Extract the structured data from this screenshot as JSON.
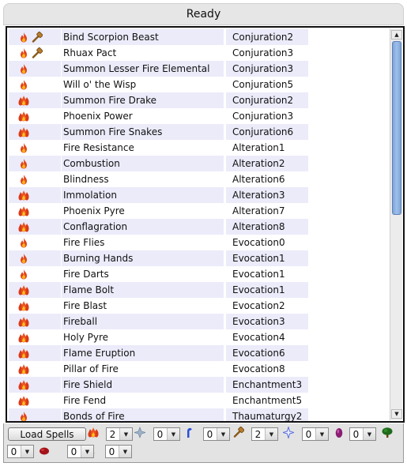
{
  "status": "Ready",
  "colors": {
    "row_alt": "#ebebfa",
    "scroll_thumb": "#8fb2e2",
    "fire": "#e0451c"
  },
  "spells": [
    {
      "name": "Bind Scorpion Beast",
      "school": "Conjuration2",
      "icons": [
        "fire-icon",
        "hammer-icon"
      ],
      "fire_level": 1
    },
    {
      "name": "Rhuax Pact",
      "school": "Conjuration3",
      "icons": [
        "fire-icon",
        "hammer-icon"
      ],
      "fire_level": 1
    },
    {
      "name": "Summon Lesser Fire Elemental",
      "school": "Conjuration3",
      "icons": [
        "fire-icon"
      ],
      "fire_level": 1
    },
    {
      "name": "Will o' the Wisp",
      "school": "Conjuration5",
      "icons": [
        "fire-icon"
      ],
      "fire_level": 1
    },
    {
      "name": "Summon Fire Drake",
      "school": "Conjuration2",
      "icons": [
        "fire-icon"
      ],
      "fire_level": 2
    },
    {
      "name": "Phoenix Power",
      "school": "Conjuration3",
      "icons": [
        "fire-icon"
      ],
      "fire_level": 2
    },
    {
      "name": "Summon Fire Snakes",
      "school": "Conjuration6",
      "icons": [
        "fire-icon"
      ],
      "fire_level": 2
    },
    {
      "name": "Fire Resistance",
      "school": "Alteration1",
      "icons": [
        "fire-icon"
      ],
      "fire_level": 1
    },
    {
      "name": "Combustion",
      "school": "Alteration2",
      "icons": [
        "fire-icon"
      ],
      "fire_level": 1
    },
    {
      "name": "Blindness",
      "school": "Alteration6",
      "icons": [
        "fire-icon"
      ],
      "fire_level": 1
    },
    {
      "name": "Immolation",
      "school": "Alteration3",
      "icons": [
        "fire-icon"
      ],
      "fire_level": 2
    },
    {
      "name": "Phoenix Pyre",
      "school": "Alteration7",
      "icons": [
        "fire-icon"
      ],
      "fire_level": 2
    },
    {
      "name": "Conflagration",
      "school": "Alteration8",
      "icons": [
        "fire-icon"
      ],
      "fire_level": 2
    },
    {
      "name": "Fire Flies",
      "school": "Evocation0",
      "icons": [
        "fire-icon"
      ],
      "fire_level": 1
    },
    {
      "name": "Burning Hands",
      "school": "Evocation1",
      "icons": [
        "fire-icon"
      ],
      "fire_level": 1
    },
    {
      "name": "Fire Darts",
      "school": "Evocation1",
      "icons": [
        "fire-icon"
      ],
      "fire_level": 1
    },
    {
      "name": "Flame Bolt",
      "school": "Evocation1",
      "icons": [
        "fire-icon"
      ],
      "fire_level": 2
    },
    {
      "name": "Fire Blast",
      "school": "Evocation2",
      "icons": [
        "fire-icon"
      ],
      "fire_level": 2
    },
    {
      "name": "Fireball",
      "school": "Evocation3",
      "icons": [
        "fire-icon"
      ],
      "fire_level": 2
    },
    {
      "name": "Holy Pyre",
      "school": "Evocation4",
      "icons": [
        "fire-icon"
      ],
      "fire_level": 2
    },
    {
      "name": "Flame Eruption",
      "school": "Evocation6",
      "icons": [
        "fire-icon"
      ],
      "fire_level": 2
    },
    {
      "name": "Pillar of Fire",
      "school": "Evocation8",
      "icons": [
        "fire-icon"
      ],
      "fire_level": 2
    },
    {
      "name": "Fire Shield",
      "school": "Enchantment3",
      "icons": [
        "fire-icon"
      ],
      "fire_level": 2
    },
    {
      "name": "Fire Fend",
      "school": "Enchantment5",
      "icons": [
        "fire-icon"
      ],
      "fire_level": 2
    },
    {
      "name": "Bonds of Fire",
      "school": "Thaumaturgy2",
      "icons": [
        "fire-icon"
      ],
      "fire_level": 1
    }
  ],
  "toolbar": {
    "load_button": "Load Spells",
    "filters": [
      {
        "icon": "fire-icon",
        "value": "2"
      },
      {
        "icon": "air-icon",
        "value": "0"
      },
      {
        "icon": "water-icon",
        "value": "0"
      },
      {
        "icon": "hammer-icon",
        "value": "2"
      },
      {
        "icon": "star-icon",
        "value": "0"
      },
      {
        "icon": "death-gem-icon",
        "value": "0"
      },
      {
        "icon": "nature-tree-icon",
        "value": "0"
      },
      {
        "icon": "blood-drop-icon",
        "value": "0"
      },
      {
        "icon": "holy-lamp-icon",
        "value": "0"
      }
    ]
  }
}
